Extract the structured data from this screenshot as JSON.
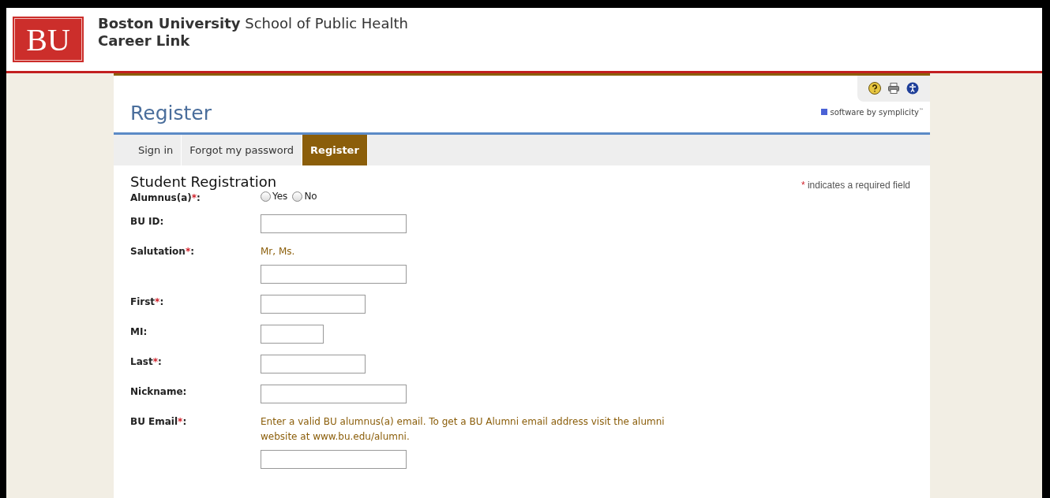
{
  "header": {
    "logo": "BU",
    "university": "Boston University",
    "school": "School of Public Health",
    "app": "Career Link"
  },
  "page": {
    "title": "Register",
    "vendor": "software by symplicity",
    "vendor_mark": "™"
  },
  "tabs": [
    {
      "label": "Sign in",
      "selected": false
    },
    {
      "label": "Forgot my password",
      "selected": false
    },
    {
      "label": "Register",
      "selected": true
    }
  ],
  "form": {
    "title": "Student Registration",
    "required_mark": "*",
    "label_suffix": ":",
    "required_note": "indicates a required field",
    "fields": [
      {
        "label": "Alumnus(a)",
        "required": true,
        "kind": "radio",
        "options": [
          {
            "label": "Yes",
            "selected": false
          },
          {
            "label": "No",
            "selected": false
          }
        ]
      },
      {
        "label": "BU ID",
        "required": false,
        "kind": "long"
      },
      {
        "label": "Salutation",
        "required": true,
        "kind": "long",
        "hint": "Mr, Ms."
      },
      {
        "label": "First",
        "required": true,
        "kind": "medium"
      },
      {
        "label": "MI",
        "required": false,
        "kind": "short"
      },
      {
        "label": "Last",
        "required": true,
        "kind": "medium"
      },
      {
        "label": "Nickname",
        "required": false,
        "kind": "long"
      },
      {
        "label": "BU Email",
        "required": true,
        "kind": "long",
        "hint": "Enter a valid BU alumnus(a) email. To get a BU Alumni email address visit the alumni website at www.bu.edu/alumni."
      }
    ]
  }
}
